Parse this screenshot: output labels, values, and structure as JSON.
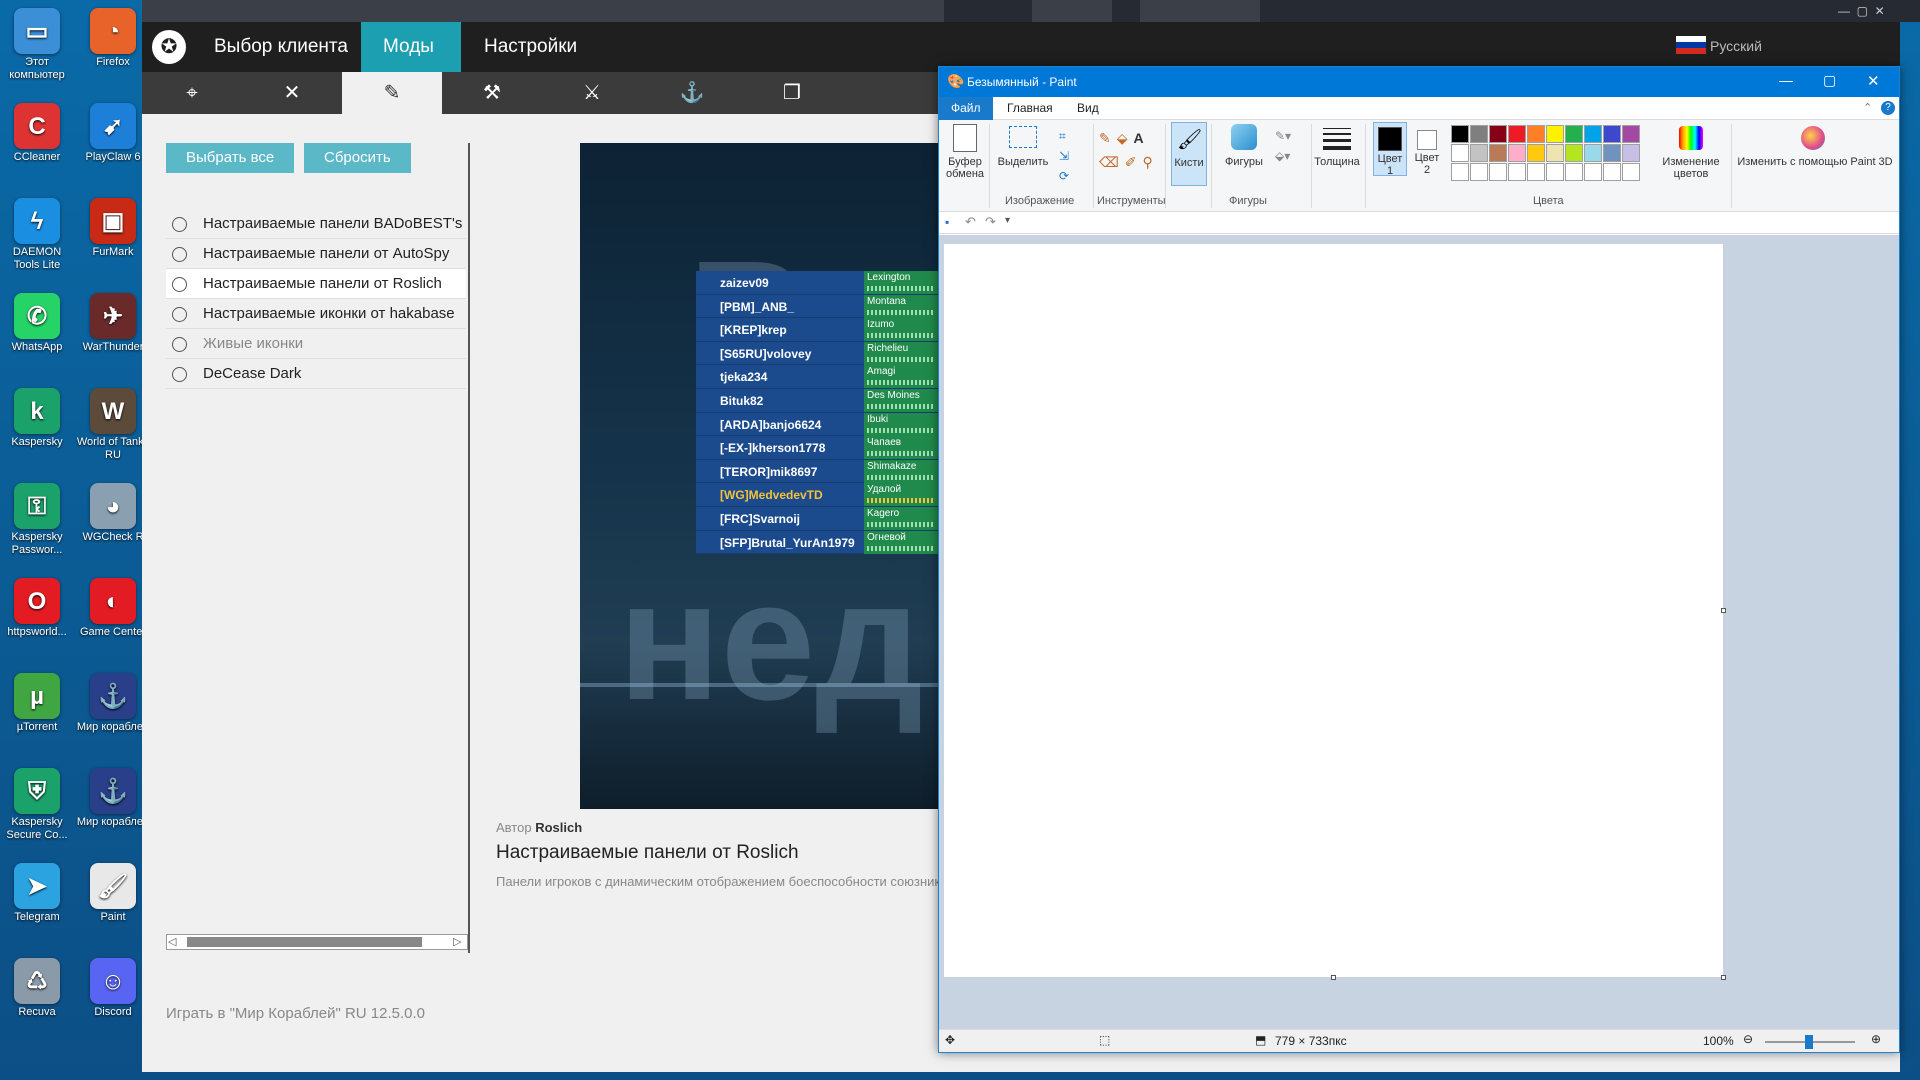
{
  "desktop": {
    "icons": [
      {
        "label": "Этот компьютер",
        "color": "#3a8fd6",
        "glyph": "▭"
      },
      {
        "label": "Firefox",
        "color": "#e8632a",
        "glyph": "◔"
      },
      {
        "label": "CCleaner",
        "color": "#d33",
        "glyph": "C"
      },
      {
        "label": "PlayClaw 6",
        "color": "#1e7fd8",
        "glyph": "➹"
      },
      {
        "label": "DAEMON Tools Lite",
        "color": "#1a8ee0",
        "glyph": "ϟ"
      },
      {
        "label": "FurMark",
        "color": "#c82a15",
        "glyph": "▣"
      },
      {
        "label": "WhatsApp",
        "color": "#25d366",
        "glyph": "✆"
      },
      {
        "label": "WarThunder",
        "color": "#6a2a2a",
        "glyph": "✈"
      },
      {
        "label": "Kaspersky",
        "color": "#1aa26a",
        "glyph": "k"
      },
      {
        "label": "World of Tanks RU",
        "color": "#5c4a3a",
        "glyph": "W"
      },
      {
        "label": "Kaspersky Passwor...",
        "color": "#1aa26a",
        "glyph": "⚿"
      },
      {
        "label": "WGCheck R",
        "color": "#8aa0b0",
        "glyph": "◕"
      },
      {
        "label": "httpsworld...",
        "color": "#e31b23",
        "glyph": "O"
      },
      {
        "label": "Game Center",
        "color": "#e31b23",
        "glyph": "◐"
      },
      {
        "label": "µTorrent",
        "color": "#3fa642",
        "glyph": "µ"
      },
      {
        "label": "Мир кораблей",
        "color": "#2a3f8a",
        "glyph": "⚓"
      },
      {
        "label": "Kaspersky Secure Co...",
        "color": "#1aa26a",
        "glyph": "⛨"
      },
      {
        "label": "Мир кораблей",
        "color": "#2a3f8a",
        "glyph": "⚓"
      },
      {
        "label": "Telegram",
        "color": "#2aa3e0",
        "glyph": "➤"
      },
      {
        "label": "Paint",
        "color": "#e8e8e8",
        "glyph": "🖌"
      },
      {
        "label": "Recuva",
        "color": "#8a9aa8",
        "glyph": "♺"
      },
      {
        "label": "Discord",
        "color": "#5865f2",
        "glyph": "☺"
      }
    ]
  },
  "modstation": {
    "tabs": [
      "Выбор клиента",
      "Моды",
      "Настройки"
    ],
    "active_tab": 1,
    "language": "Русский",
    "tool_icons": [
      "crosshair-icon",
      "wrench-cross-icon",
      "panel-edit-icon",
      "hammer-icon",
      "swords-icon",
      "anchor-icon",
      "layers-icon"
    ],
    "tool_glyphs": [
      "⌖",
      "✕",
      "✎",
      "⚒",
      "⚔",
      "⚓",
      "❐"
    ],
    "select_all": "Выбрать все",
    "reset": "Сбросить",
    "mods": [
      "Настраиваемые панели BADoBEST's S",
      "Настраиваемые панели от AutoSpy",
      "Настраиваемые панели от Roslich",
      "Настраиваемые иконки от hakabase",
      "Живые иконки",
      "DeCease Dark"
    ],
    "selected_mod": 2,
    "preview": {
      "big_text_1": "Вр",
      "big_text_2": "нед",
      "players": [
        {
          "name": "zaizev09",
          "ship": "Lexington"
        },
        {
          "name": "[PBM]_ANB_",
          "ship": "Montana"
        },
        {
          "name": "[KREP]krep",
          "ship": "Izumo"
        },
        {
          "name": "[S65RU]volovey",
          "ship": "Richelieu"
        },
        {
          "name": "tjeka234",
          "ship": "Amagi"
        },
        {
          "name": "Bituk82",
          "ship": "Des Moines"
        },
        {
          "name": "[ARDA]banjo6624",
          "ship": "Ibuki"
        },
        {
          "name": "[-EX-]kherson1778",
          "ship": "Чапаев"
        },
        {
          "name": "[TEROR]mik8697",
          "ship": "Shimakaze"
        },
        {
          "name": "[WG]MedvedevTD",
          "ship": "Удалой",
          "gold": true
        },
        {
          "name": "[FRC]Svarnoij",
          "ship": "Kagero"
        },
        {
          "name": "[SFP]Brutal_YurAn1979",
          "ship": "Огневой"
        }
      ]
    },
    "author_label": "Автор",
    "author": "Roslich",
    "mod_title": "Настраиваемые панели от Roslich",
    "mod_desc": "Панели игроков с динамическим отображением боеспособности союзник",
    "footer": "Играть в \"Мир Кораблей\" RU 12.5.0.0"
  },
  "paint": {
    "title": "Безымянный - Paint",
    "tabs": [
      "Файл",
      "Главная",
      "Вид"
    ],
    "clipboard": "Буфер обмена",
    "select": "Выделить",
    "group_image": "Изображение",
    "group_tools": "Инструменты",
    "brushes": "Кисти",
    "shapes": "Фигуры",
    "group_shapes": "Фигуры",
    "thickness": "Толщина",
    "color1": "Цвет 1",
    "color2": "Цвет 2",
    "group_colors": "Цвета",
    "edit_colors": "Изменение цветов",
    "paint3d": "Изменить с помощью Paint 3D",
    "palette": [
      "#000000",
      "#7f7f7f",
      "#880015",
      "#ed1c24",
      "#ff7f27",
      "#fff200",
      "#22b14c",
      "#00a2e8",
      "#3f48cc",
      "#a349a4",
      "#ffffff",
      "#c3c3c3",
      "#b97a57",
      "#ffaec9",
      "#ffc90e",
      "#efe4b0",
      "#b5e61d",
      "#99d9ea",
      "#7092be",
      "#c8bfe7"
    ],
    "canvas_size": "779 × 733пкс",
    "zoom": "100%"
  }
}
